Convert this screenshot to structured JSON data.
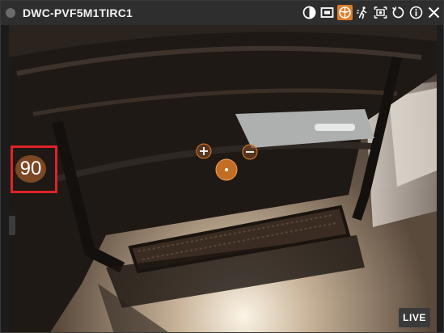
{
  "window": {
    "camera_name": "DWC-PVF5M1TIRC1"
  },
  "toolbar": {
    "buttons": [
      {
        "icon": "contrast-icon",
        "active": false
      },
      {
        "icon": "window-icon",
        "active": false
      },
      {
        "icon": "fisheye-icon",
        "active": true
      },
      {
        "icon": "motion-icon",
        "active": false
      },
      {
        "icon": "snapshot-icon",
        "active": false
      },
      {
        "icon": "refresh-icon",
        "active": false
      },
      {
        "icon": "info-icon",
        "active": false
      },
      {
        "icon": "close-icon",
        "active": false
      }
    ]
  },
  "ptz": {
    "preset_value": "90",
    "zoom_in_symbol": "+",
    "zoom_out_symbol": "−"
  },
  "status": {
    "live_label": "LIVE"
  },
  "colors": {
    "accent": "#e07c27",
    "highlight_box": "#e0232a",
    "titlebar": "#2e2e2e"
  }
}
